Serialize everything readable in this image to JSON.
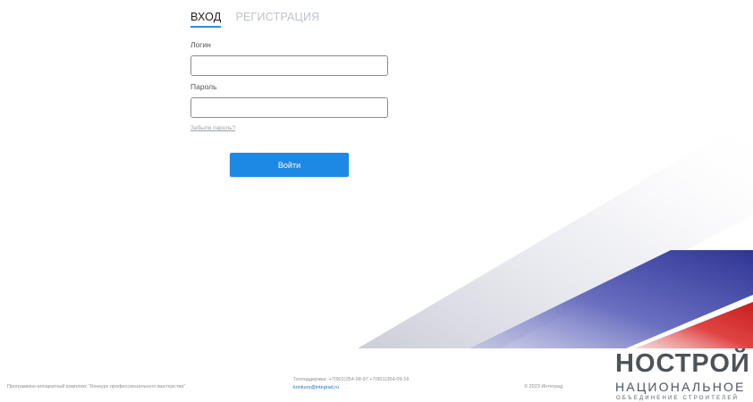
{
  "tabs": [
    {
      "label": "ВХОД",
      "active": true
    },
    {
      "label": "РЕГИСТРАЦИЯ",
      "active": false
    }
  ],
  "form": {
    "login_label": "Логин",
    "login_value": "",
    "password_label": "Пароль",
    "password_value": "",
    "forgot_label": "Забыли пароль?",
    "submit_label": "Войти"
  },
  "footer": {
    "product_text": "Программно-аппаратный комплекс \"Конкурс профессионального мастерства\"",
    "support_text": "Техподдержка: +7(901)354-08-97 +7(901)354-09-16",
    "email": "konkurs@integrad.ru",
    "copyright": "© 2023 Интеград"
  },
  "logo": {
    "main": "НОСТРОЙ",
    "line1": "НАЦИОНАЛЬНОЕ",
    "line2": "ОБЪЕДИНЕНИЕ СТРОИТЕЛЕЙ",
    "icon": "nostroy-flag-logo"
  },
  "colors": {
    "accent": "#1e88e5",
    "flag_white": "#e8e9ef",
    "flag_blue": "#3a3f9e",
    "flag_red": "#d92b2b",
    "text_gray": "#4d5358"
  }
}
